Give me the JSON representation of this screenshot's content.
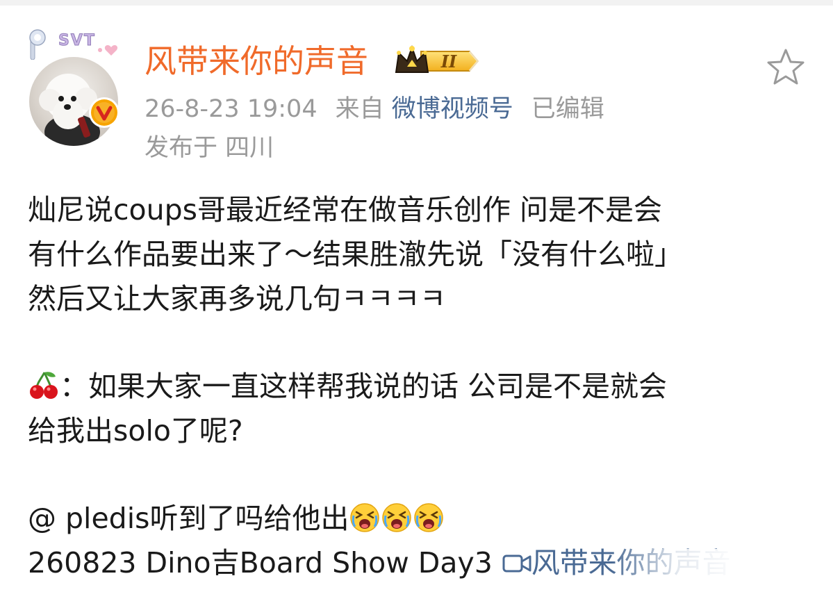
{
  "post": {
    "username": "风带来你的声音",
    "level_badge": "II",
    "avatar_badge": "SVT",
    "timestamp": "26-8-23 19:04",
    "source_prefix": "来自",
    "source_name": "微博视频号",
    "edited": "已编辑",
    "location": "发布于 四川",
    "body": {
      "p1_l1": "灿尼说coups哥最近经常在做音乐创作 问是不是会",
      "p1_l2": "有什么作品要出来了～结果胜澈先说「没有什么啦」",
      "p1_l3": "然后又让大家再多说几句ㅋㅋㅋㅋ",
      "p2_l1": "：如果大家一直这样帮我说的话 公司是不是就会",
      "p2_l2": "给我出solo了呢?",
      "p3_l1": "@ pledis听到了吗给他出",
      "p3_l2_prefix": "260823 Dino吉Board Show Day3",
      "video_link": "风带来你的声音"
    }
  },
  "icons": {
    "favorite": "star-outline-icon",
    "cherry": "cherry-emoji",
    "crying": "crying-face-emoji",
    "video": "video-camera-icon",
    "verified": "verified-v-icon",
    "crown": "crown-icon"
  },
  "colors": {
    "username": "#f06a2a",
    "link": "#4a6a94",
    "meta": "#9a9a9a",
    "verified": "#f7a400"
  }
}
